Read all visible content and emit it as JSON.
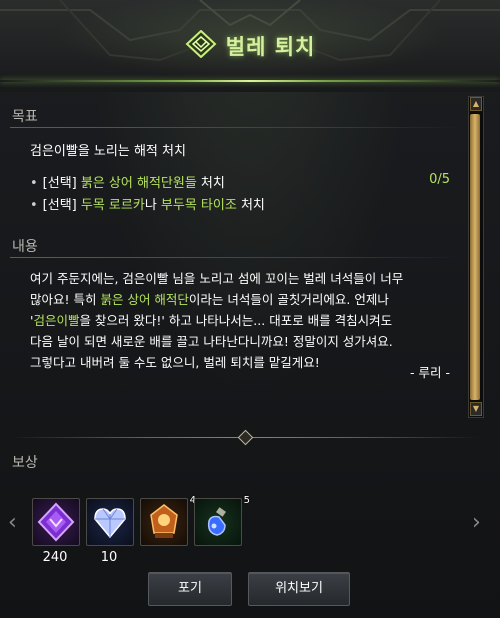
{
  "window": {
    "title": "벌레 퇴치"
  },
  "goal": {
    "label": "목표",
    "main": "검은이빨을 노리는 해적 처치",
    "items": [
      {
        "bullet": "•",
        "prefix": "[선택] ",
        "highlight": "붉은 상어 해적단원들",
        "suffix": " 처치",
        "count": "0/5"
      },
      {
        "bullet": "•",
        "prefix": "[선택] ",
        "highlight": "두목 로르카",
        "middle": "나 ",
        "highlight2": "부두목 타이조",
        "suffix": " 처치"
      }
    ]
  },
  "content": {
    "label": "내용",
    "line1": "여기 주둔지에는, 검은이빨 님을 노리고 섬에 꼬이는 벌레 녀석들이 너무",
    "line2_a": "많아요! 특히 ",
    "line2_hl": "붉은 상어 해적단",
    "line2_b": "이라는 녀석들이 골칫거리에요. 언제나",
    "line3_a": "'",
    "line3_hl": "검은이빨",
    "line3_b": "을 찾으러 왔다!' 하고 나타나서는... 대포로 배를 격침시켜도",
    "line4": "다음 날이 되면 새로운 배를 끌고 나타난다니까요! 정말이지 성가셔요.",
    "line5": "그렇다고 내버려 둘 수도 없으니, 벌레 퇴치를 맡길게요!",
    "signature": "- 루리 -"
  },
  "reward": {
    "label": "보상",
    "prev_icon": "chevron-left-icon",
    "next_icon": "chevron-right-icon",
    "items": [
      {
        "icon": "purple-crest-icon",
        "value": "240",
        "count": ""
      },
      {
        "icon": "crystal-heart-icon",
        "value": "10",
        "count": ""
      },
      {
        "icon": "fire-gem-box-icon",
        "value": "",
        "count": "4"
      },
      {
        "icon": "blue-potion-icon",
        "value": "",
        "count": "5"
      }
    ]
  },
  "buttons": {
    "abandon": "포기",
    "locate": "위치보기"
  },
  "colors": {
    "highlight": "#b5e35c",
    "title": "#d6f0a0",
    "scroll_thumb": "#d8b36a"
  }
}
